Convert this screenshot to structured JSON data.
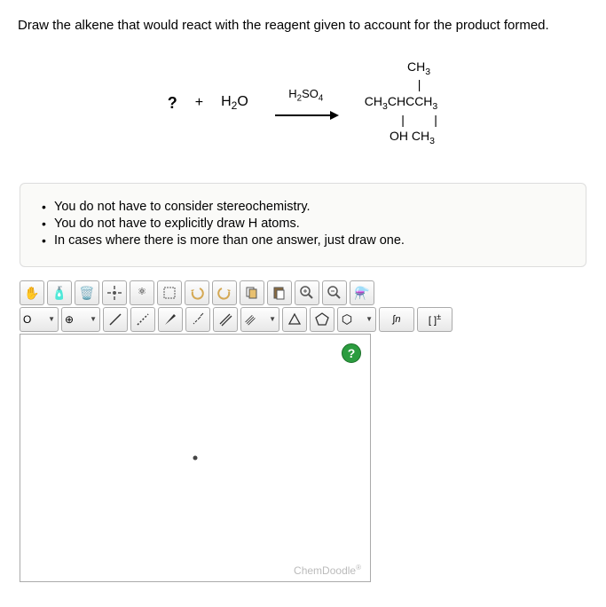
{
  "question": "Draw the alkene that would react with the reagent given to account for the product formed.",
  "reaction": {
    "unknown": "?",
    "plus": "+",
    "reagent": "H₂O",
    "catalyst": "H₂SO₄",
    "product_top": "CH₃",
    "product_bar1": "|",
    "product_main": "CH₃CHCCH₃",
    "product_bar2": "|    |",
    "product_bottom": "OH CH₃"
  },
  "instructions": [
    "You do not have to consider stereochemistry.",
    "You do not have to explicitly draw H atoms.",
    "In cases where there is more than one answer, just draw one."
  ],
  "toolbar": {
    "element": "O",
    "add": "⊕",
    "help": "?",
    "script": "∫n",
    "brackets": "[ ]",
    "charge": "±"
  },
  "footer": "ChemDoodle"
}
